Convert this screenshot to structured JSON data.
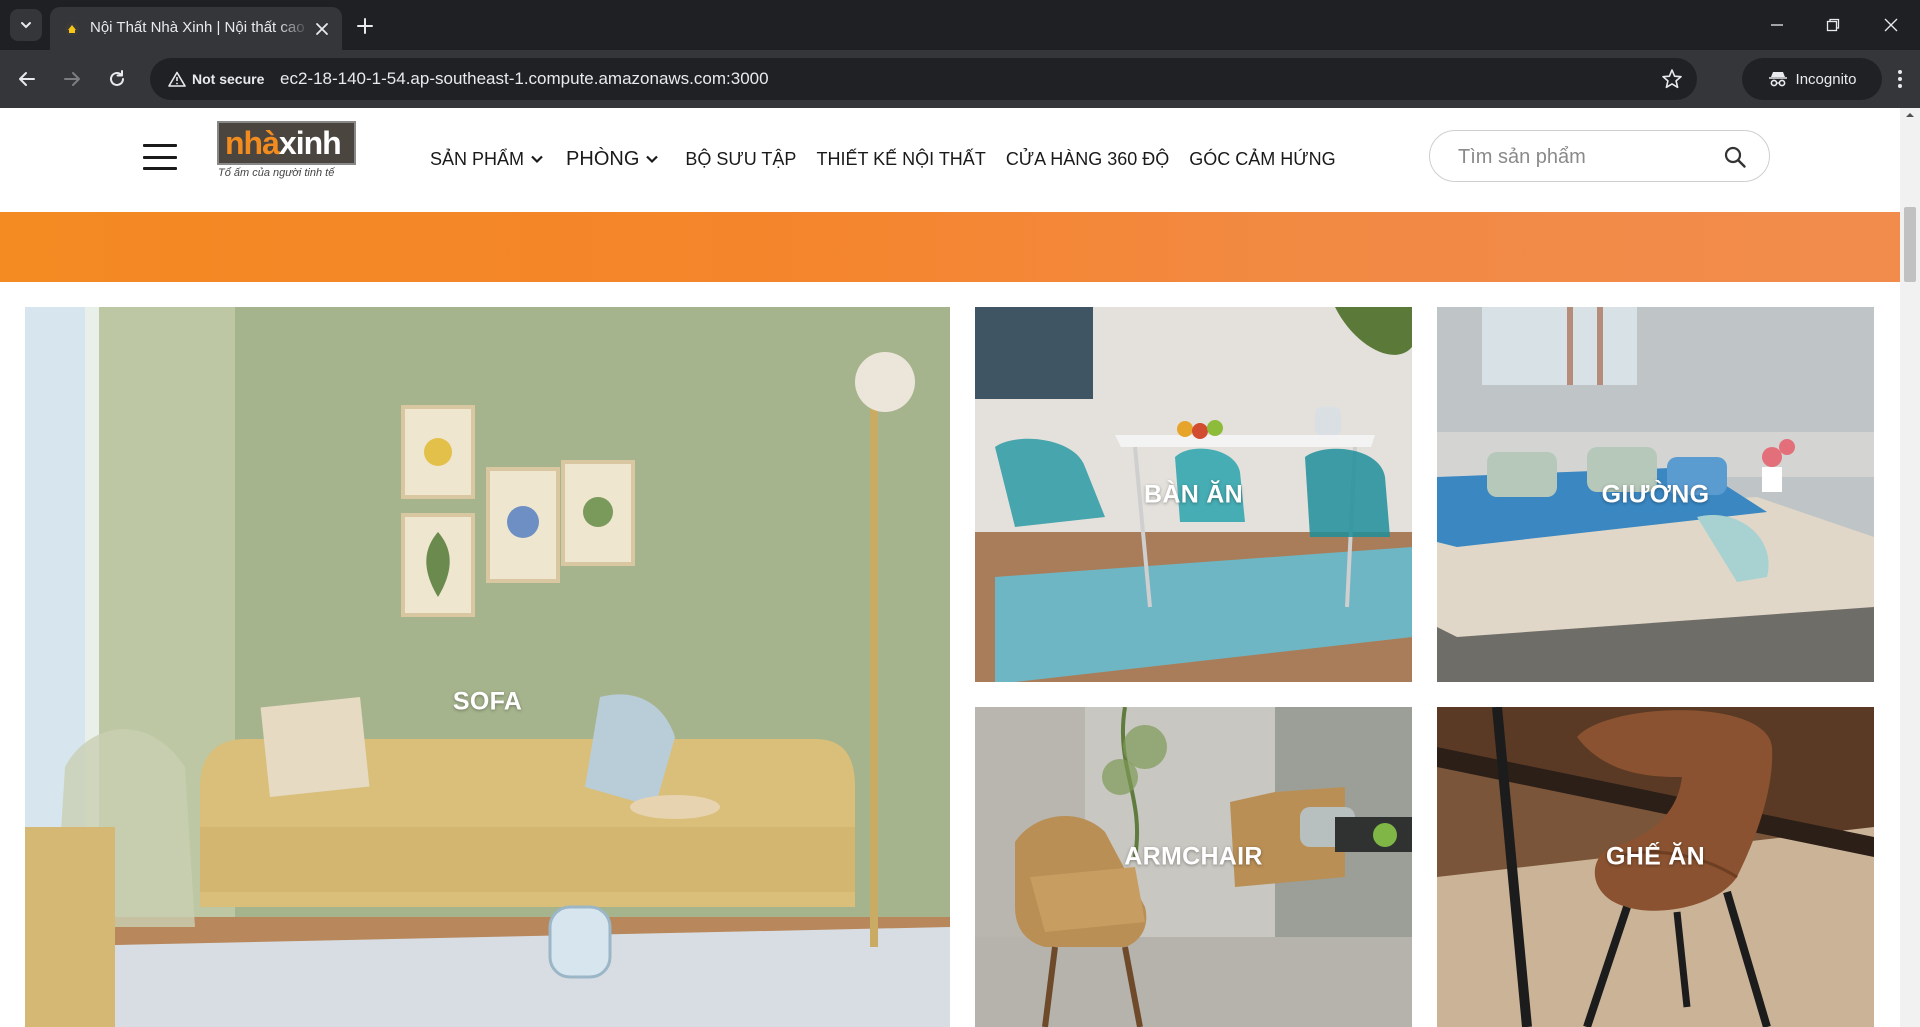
{
  "browser": {
    "tab_title": "Nội Thất Nhà Xinh | Nội thất cao cấp",
    "security_label": "Not secure",
    "url": "ec2-18-140-1-54.ap-southeast-1.compute.amazonaws.com:3000",
    "profile_label": "Incognito",
    "icons": [
      "tab-search-icon",
      "favicon-icon",
      "close-tab-icon",
      "new-tab-icon",
      "minimize-icon",
      "restore-icon",
      "close-window-icon",
      "back-icon",
      "forward-icon",
      "reload-icon",
      "warning-icon",
      "bookmark-star-icon",
      "incognito-icon",
      "more-menu-icon"
    ]
  },
  "site": {
    "logo": {
      "word_a": "nhà",
      "word_b": "xinh",
      "tagline": "Tổ ấm của người tinh tế"
    },
    "nav": [
      {
        "label": "SẢN PHẨM",
        "has_dropdown": true
      },
      {
        "label": "PHÒNG",
        "has_dropdown": true
      },
      {
        "label": "BỘ SƯU TẬP",
        "has_dropdown": false
      },
      {
        "label": "THIẾT KẾ NỘI THẤT",
        "has_dropdown": false
      },
      {
        "label": "CỬA HÀNG 360 ĐỘ",
        "has_dropdown": false
      },
      {
        "label": "GÓC CẢM HỨNG",
        "has_dropdown": false
      }
    ],
    "search": {
      "placeholder": "Tìm sản phẩm",
      "value": ""
    },
    "banner_color": "#f38a22",
    "categories": [
      {
        "label": "SOFA"
      },
      {
        "label": "BÀN ĂN"
      },
      {
        "label": "GIƯỜNG"
      },
      {
        "label": "ARMCHAIR"
      },
      {
        "label": "GHẾ ĂN"
      }
    ]
  }
}
